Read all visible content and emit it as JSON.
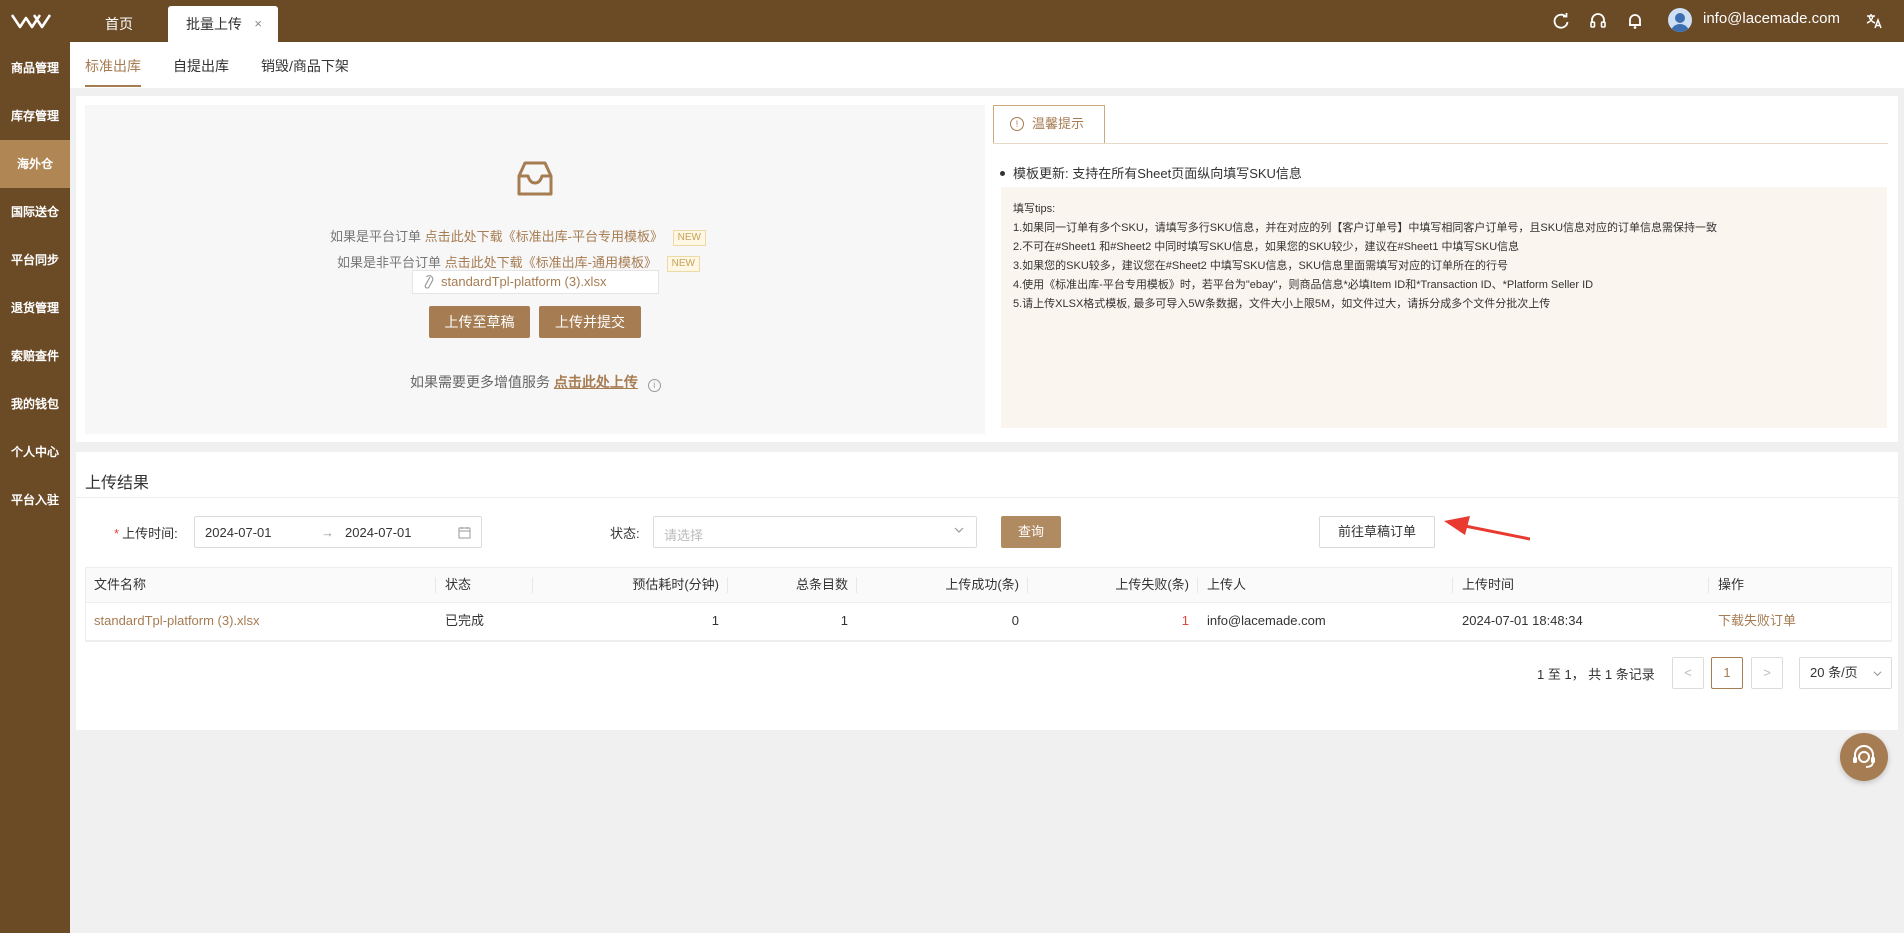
{
  "header": {
    "home_tab": "首页",
    "active_tab": "批量上传",
    "close_glyph": "×",
    "user_email": "info@lacemade.com",
    "icons": [
      "refresh-icon",
      "headset-icon",
      "bell-icon",
      "translate-icon"
    ]
  },
  "sidebar": {
    "items": [
      {
        "label": "商品管理"
      },
      {
        "label": "库存管理"
      },
      {
        "label": "海外仓"
      },
      {
        "label": "国际送仓"
      },
      {
        "label": "平台同步"
      },
      {
        "label": "退货管理"
      },
      {
        "label": "索赔查件"
      },
      {
        "label": "我的钱包"
      },
      {
        "label": "个人中心"
      },
      {
        "label": "平台入驻"
      }
    ],
    "active_index": 2
  },
  "subtabs": [
    "标准出库",
    "自提出库",
    "销毁/商品下架"
  ],
  "upload": {
    "line1_prefix": "如果是平台订单",
    "line1_link": "点击此处下载《标准出库-平台专用模板》",
    "line2_prefix": "如果是非平台订单",
    "line2_link": "点击此处下载《标准出库-通用模板》",
    "new_badge": "NEW",
    "file_name": "standardTpl-platform (3).xlsx",
    "btn_draft": "上传至草稿",
    "btn_submit": "上传并提交",
    "more_prefix": "如果需要更多增值服务",
    "more_link": "点击此处上传"
  },
  "tips": {
    "tab_label": "温馨提示",
    "bullet": "模板更新: 支持在所有Sheet页面纵向填写SKU信息",
    "title": "填写tips:",
    "lines": [
      "1.如果同一订单有多个SKU，请填写多行SKU信息，并在对应的列【客户订单号】中填写相同客户订单号，且SKU信息对应的订单信息需保持一致",
      "2.不可在#Sheet1 和#Sheet2 中同时填写SKU信息，如果您的SKU较少，建议在#Sheet1 中填写SKU信息",
      "3.如果您的SKU较多，建议您在#Sheet2 中填写SKU信息，SKU信息里面需填写对应的订单所在的行号",
      "4.使用《标准出库-平台专用模板》时，若平台为\"ebay\"，则商品信息*必填Item ID和*Transaction ID、*Platform Seller ID",
      "5.请上传XLSX格式模板, 最多可导入5W条数据，文件大小上限5M，如文件过大，请拆分成多个文件分批次上传"
    ]
  },
  "results": {
    "title": "上传结果",
    "upload_time_label": "上传时间:",
    "date_start": "2024-07-01",
    "date_sep": "→",
    "date_end": "2024-07-01",
    "status_label": "状态:",
    "status_placeholder": "请选择",
    "query_btn": "查询",
    "draft_orders_btn": "前往草稿订单",
    "columns": [
      "文件名称",
      "状态",
      "预估耗时(分钟)",
      "总条目数",
      "上传成功(条)",
      "上传失败(条)",
      "上传人",
      "上传时间",
      "操作"
    ],
    "rows": [
      {
        "file": "standardTpl-platform (3).xlsx",
        "status": "已完成",
        "eta": "1",
        "total": "1",
        "success": "0",
        "failed": "1",
        "uploader": "info@lacemade.com",
        "time": "2024-07-01 18:48:34",
        "action": "下载失败订单"
      }
    ]
  },
  "pagination": {
    "summary": "1 至 1， 共 1 条记录",
    "prev": "<",
    "current": "1",
    "next": ">",
    "page_size": "20 条/页"
  },
  "colors": {
    "brand": "#6b4a26",
    "accent": "#a67c52",
    "danger": "#e0463c"
  }
}
